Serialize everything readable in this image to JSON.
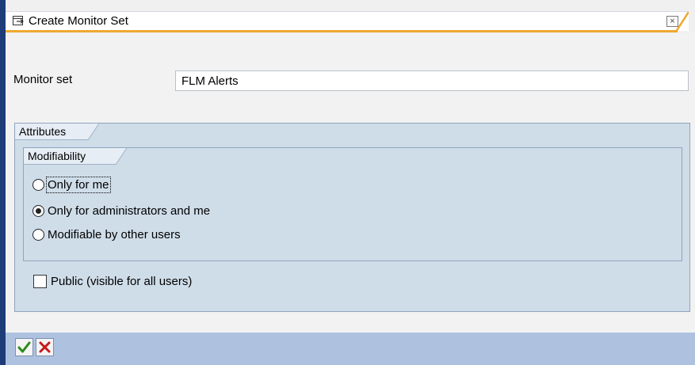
{
  "window": {
    "title": "Create Monitor Set",
    "close_label": "×"
  },
  "form": {
    "monitor_set_label": "Monitor set",
    "monitor_set_value": "FLM Alerts"
  },
  "attributes": {
    "group_label": "Attributes",
    "modifiability": {
      "group_label": "Modifiability",
      "options": [
        {
          "label": "Only for me",
          "selected": false,
          "focused": true
        },
        {
          "label": "Only for administrators and me",
          "selected": true,
          "focused": false
        },
        {
          "label": "Modifiable by other users",
          "selected": false,
          "focused": false
        }
      ]
    },
    "public_label": "Public (visible for all users)",
    "public_checked": false
  },
  "colors": {
    "accent": "#efa830",
    "frame": "#1d3c78",
    "toolbar": "#aec2e0",
    "group_bg": "#cfdde9",
    "ok_green": "#2d8a1a",
    "cancel_red": "#c81818"
  },
  "icons": {
    "title": "dialog-window-icon",
    "ok": "checkmark-icon",
    "cancel": "cancel-x-icon"
  }
}
